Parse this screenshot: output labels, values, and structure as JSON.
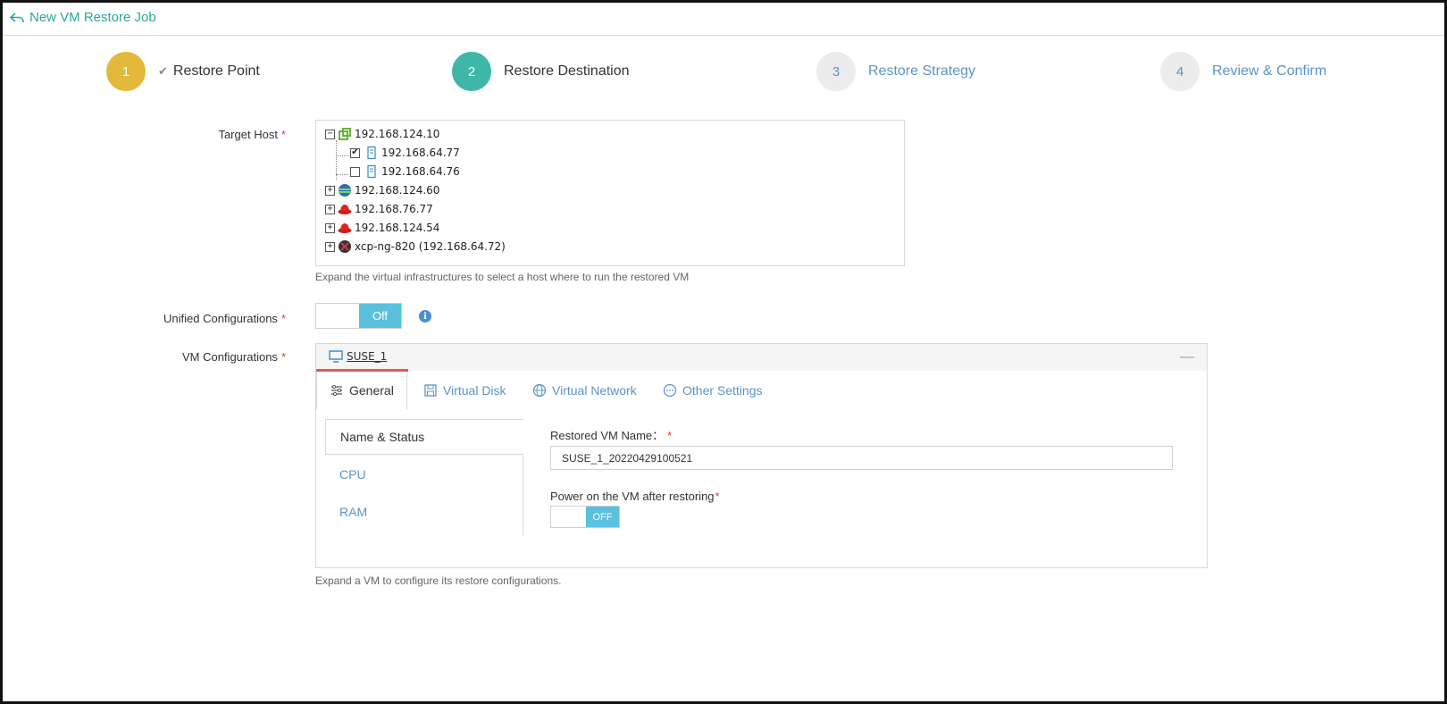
{
  "header": {
    "back_label": "New VM Restore Job"
  },
  "steps": [
    {
      "number": "1",
      "label": "Restore Point",
      "check": "✔"
    },
    {
      "number": "2",
      "label": "Restore Destination"
    },
    {
      "number": "3",
      "label": "Restore Strategy"
    },
    {
      "number": "4",
      "label": "Review & Confirm"
    }
  ],
  "target_host": {
    "label": "Target Host",
    "required": "*",
    "tree": [
      {
        "label": "192.168.124.10",
        "toggle": "−",
        "icon": "vmware-icon"
      },
      {
        "label": "192.168.64.77",
        "checked": "✔",
        "icon": "server-icon"
      },
      {
        "label": "192.168.64.76",
        "checked": "",
        "icon": "server-icon"
      },
      {
        "label": "192.168.124.60",
        "toggle": "+",
        "icon": "hyperv-icon"
      },
      {
        "label": "192.168.76.77",
        "toggle": "+",
        "icon": "redhat-icon"
      },
      {
        "label": "192.168.124.54",
        "toggle": "+",
        "icon": "redhat-icon"
      },
      {
        "label": "xcp-ng-820 (192.168.64.72)",
        "toggle": "+",
        "icon": "xcpng-icon"
      }
    ],
    "hint": "Expand the virtual infrastructures to select a host where to run the restored VM"
  },
  "unified": {
    "label": "Unified Configurations",
    "required": "*",
    "switch_label": "Off",
    "info": "i"
  },
  "vm_config": {
    "label": "VM Configurations",
    "required": "*",
    "vm_name_tab": "SUSE_1",
    "collapse": "—",
    "tabs": [
      "General",
      "Virtual Disk",
      "Virtual Network",
      "Other Settings"
    ],
    "side_items": [
      "Name & Status",
      "CPU",
      "RAM"
    ],
    "restored_name_label": "Restored VM Name：",
    "restored_name_value": "SUSE_1_20220429100521",
    "power_label": "Power on the VM after restoring",
    "power_switch": "OFF",
    "hint": "Expand a VM to configure its restore configurations."
  },
  "colors": {
    "accent_teal": "#3eb7a9",
    "step1_gold": "#e2b93b",
    "link_blue": "#5a95c8",
    "switch_blue": "#5bc0de",
    "required_red": "#e53935"
  }
}
